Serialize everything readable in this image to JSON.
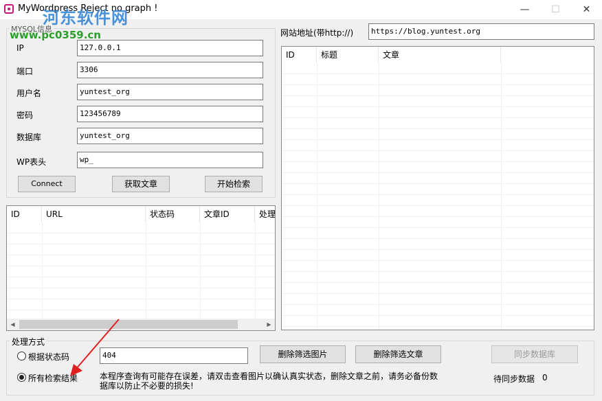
{
  "window": {
    "title": "MyWordpress Reject no graph !",
    "minimize": "—",
    "maximize": "☐",
    "close": "✕"
  },
  "watermark": {
    "title": "河东软件网",
    "url": "www.pc0359.cn"
  },
  "mysql": {
    "group_title": "MYSQL信息",
    "fields": [
      {
        "label": "IP",
        "value": "127.0.0.1"
      },
      {
        "label": "端口",
        "value": "3306"
      },
      {
        "label": "用户名",
        "value": "yuntest_org"
      },
      {
        "label": "密码",
        "value": "123456789"
      },
      {
        "label": "数据库",
        "value": "yuntest_org"
      },
      {
        "label": "WP表头",
        "value": "wp_"
      }
    ],
    "connect_label": "Connect",
    "fetch_label": "获取文章",
    "search_label": "开始检索"
  },
  "site": {
    "label": "网站地址(带http://)",
    "value": "https://blog.yuntest.org"
  },
  "results_table": {
    "columns": [
      "ID",
      "URL",
      "状态码",
      "文章ID",
      "处理"
    ]
  },
  "articles_table": {
    "columns": [
      "ID",
      "标题",
      "文章"
    ]
  },
  "process": {
    "group_title": "处理方式",
    "radio_status": "根据状态码",
    "radio_all": "所有检索结果",
    "status_value": "404",
    "delete_images_label": "删除筛选图片",
    "delete_articles_label": "删除筛选文章",
    "sync_label": "同步数据库",
    "note": "本程序查询有可能存在误差，请双击查看图片以确认真实状态，删除文章之前，请务必备份数据库以防止不必要的损失!",
    "pending_label": "待同步数据",
    "pending_count": "0"
  }
}
